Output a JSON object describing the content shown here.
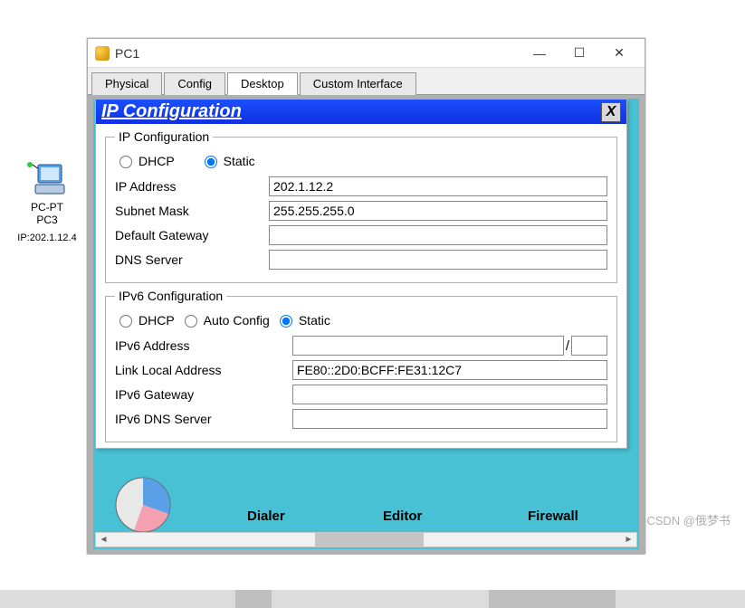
{
  "desktop_icon": {
    "label1": "PC-PT",
    "label2": "PC3",
    "ip": "IP:202.1.12.4"
  },
  "window": {
    "title": "PC1",
    "controls": {
      "min": "—",
      "max": "☐",
      "close": "✕"
    },
    "tabs": [
      "Physical",
      "Config",
      "Desktop",
      "Custom Interface"
    ],
    "active_tab": 2
  },
  "panel": {
    "title": "IP Configuration",
    "close": "X",
    "ipv4": {
      "legend": "IP Configuration",
      "modes": {
        "dhcp": "DHCP",
        "static": "Static"
      },
      "selected": "static",
      "ip_label": "IP Address",
      "ip_value": "202.1.12.2",
      "mask_label": "Subnet Mask",
      "mask_value": "255.255.255.0",
      "gw_label": "Default Gateway",
      "gw_value": "",
      "dns_label": "DNS Server",
      "dns_value": ""
    },
    "ipv6": {
      "legend": "IPv6 Configuration",
      "modes": {
        "dhcp": "DHCP",
        "auto": "Auto Config",
        "static": "Static"
      },
      "selected": "static",
      "addr_label": "IPv6 Address",
      "addr_value": "",
      "prefix_value": "",
      "ll_label": "Link Local Address",
      "ll_value": "FE80::2D0:BCFF:FE31:12C7",
      "gw_label": "IPv6 Gateway",
      "gw_value": "",
      "dns_label": "IPv6 DNS Server",
      "dns_value": ""
    }
  },
  "bg_labels": {
    "a": "Dialer",
    "b": "Editor",
    "c": "Firewall"
  },
  "watermark": "CSDN @俄梦书"
}
